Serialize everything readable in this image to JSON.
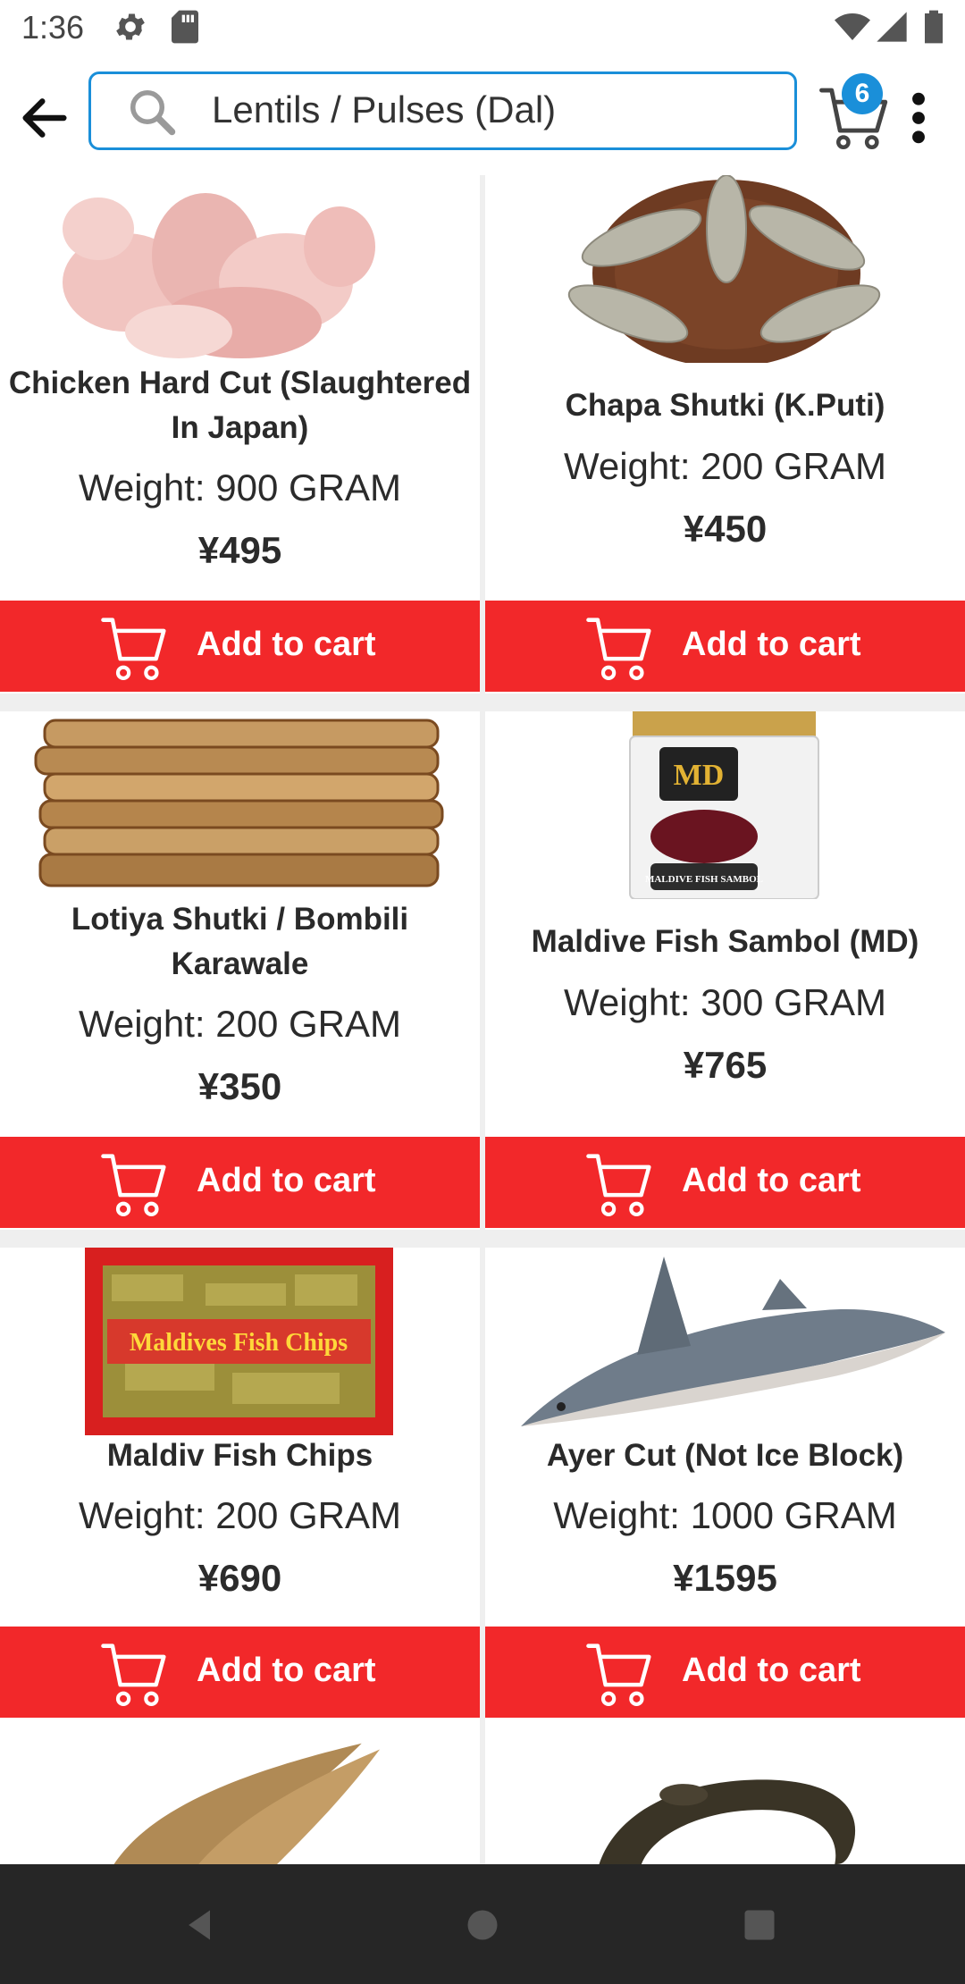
{
  "status": {
    "time": "1:36"
  },
  "search": {
    "query": "Lentils / Pulses (Dal)"
  },
  "cart": {
    "count": "6"
  },
  "products": [
    {
      "name": "Chicken Hard Cut (Slaughtered In Japan)",
      "weight": "Weight: 900 GRAM",
      "price": "¥495",
      "button": "Add to cart"
    },
    {
      "name": "Chapa Shutki (K.Puti)",
      "weight": "Weight: 200 GRAM",
      "price": "¥450",
      "button": "Add to cart"
    },
    {
      "name": "Lotiya Shutki / Bombili Karawale",
      "weight": "Weight: 200 GRAM",
      "price": "¥350",
      "button": "Add to cart"
    },
    {
      "name": "Maldive Fish Sambol (MD)",
      "weight": "Weight: 300 GRAM",
      "price": "¥765",
      "button": "Add to cart"
    },
    {
      "name": "Maldiv Fish Chips",
      "weight": "Weight: 200 GRAM",
      "price": "¥690",
      "button": "Add to cart"
    },
    {
      "name": "Ayer Cut (Not Ice Block)",
      "weight": "Weight: 1000 GRAM",
      "price": "¥1595",
      "button": "Add to cart"
    }
  ],
  "product_images": {
    "md_logo": "MD",
    "md_label": "MALDIVE FISH SAMBOL",
    "chips_label": "Maldives Fish Chips"
  },
  "colors": {
    "accent": "#1a8fd9",
    "button": "#f2282a"
  }
}
